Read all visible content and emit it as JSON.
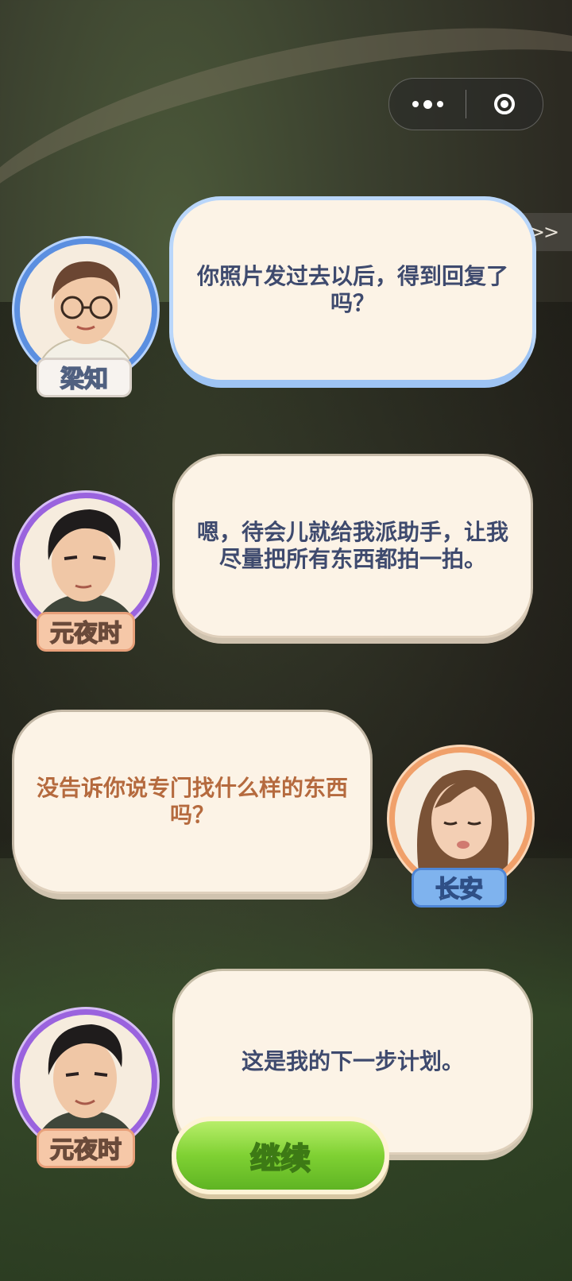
{
  "capsule": {
    "more_icon": "more-dots-icon",
    "close_icon": "target-circle-icon"
  },
  "skip": {
    "label": ">>"
  },
  "dialogs": [
    {
      "speaker": "梁知",
      "text": "你照片发过去以后，得到回复了吗？",
      "side": "left",
      "theme": "blue"
    },
    {
      "speaker": "元夜时",
      "text": "嗯，待会儿就给我派助手，让我尽量把所有东西都拍一拍。",
      "side": "left",
      "theme": "purple"
    },
    {
      "speaker": "长安",
      "text": "没告诉你说专门找什么样的东西吗？",
      "side": "right",
      "theme": "orange"
    },
    {
      "speaker": "元夜时",
      "text": "这是我的下一步计划。",
      "side": "left",
      "theme": "purple"
    }
  ],
  "continue_button": {
    "label": "继续"
  },
  "colors": {
    "blue_accent": "#5b8fe0",
    "purple_accent": "#9a63de",
    "orange_accent": "#f0a06a",
    "green_button": "#7fd133"
  }
}
